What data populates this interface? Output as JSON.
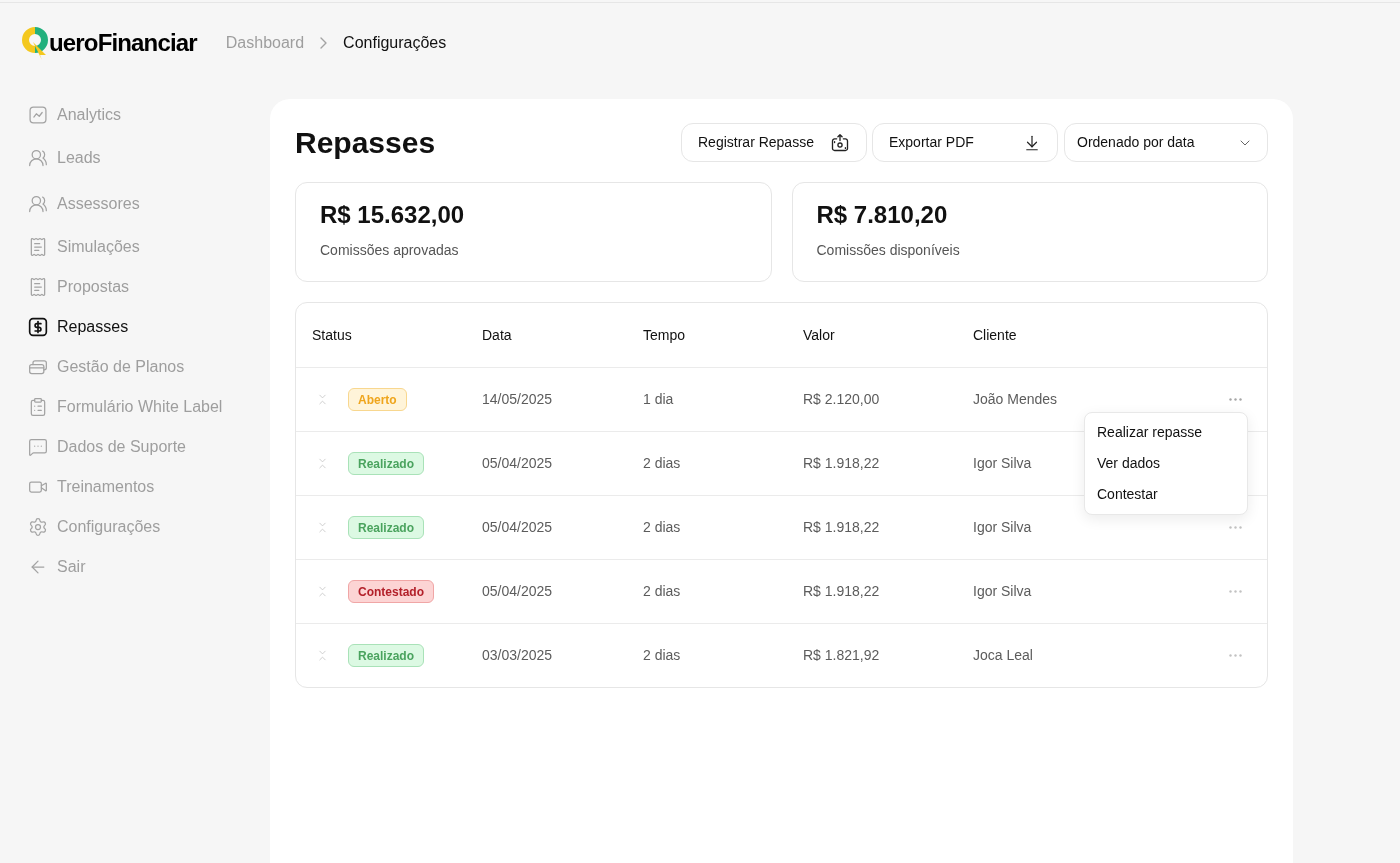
{
  "header": {
    "logo": {
      "text": "ueroFinanciar"
    },
    "breadcrumbs": [
      {
        "label": "Dashboard",
        "current": false
      },
      {
        "label": "Configurações",
        "current": true
      }
    ]
  },
  "sidebar": {
    "items": [
      {
        "label": "Analytics",
        "selected": false
      },
      {
        "label": "Leads",
        "selected": false
      },
      {
        "label": "Assessores",
        "selected": false
      },
      {
        "label": "Simulações",
        "selected": false
      },
      {
        "label": "Propostas",
        "selected": false
      },
      {
        "label": "Repasses",
        "selected": true
      },
      {
        "label": "Gestão de Planos",
        "selected": false
      },
      {
        "label": "Formulário White Label",
        "selected": false
      },
      {
        "label": "Dados de Suporte",
        "selected": false
      },
      {
        "label": "Treinamentos",
        "selected": false
      },
      {
        "label": "Configurações",
        "selected": false
      },
      {
        "label": "Sair",
        "selected": false
      }
    ]
  },
  "page": {
    "title": "Repasses",
    "actions": [
      {
        "label": "Registrar Repasse"
      },
      {
        "label": "Exportar PDF"
      }
    ],
    "sort": {
      "value": "Ordenado por data"
    },
    "stats": [
      {
        "value": "R$ 15.632,00",
        "label": "Comissões aprovadas"
      },
      {
        "value": "R$ 7.810,20",
        "label": "Comissões disponíveis"
      }
    ],
    "table": {
      "columns": [
        "Status",
        "Data",
        "Tempo",
        "Valor",
        "Cliente"
      ],
      "rows": [
        {
          "status": {
            "label": "Aberto",
            "kind": "open"
          },
          "date": "14/05/2025",
          "time": "1 dia",
          "value": "R$ 2.120,00",
          "client": "João Mendes",
          "menu_open": true
        },
        {
          "status": {
            "label": "Realizado",
            "kind": "done"
          },
          "date": "05/04/2025",
          "time": "2 dias",
          "value": "R$ 1.918,22",
          "client": "Igor Silva",
          "menu_open": false
        },
        {
          "status": {
            "label": "Realizado",
            "kind": "done"
          },
          "date": "05/04/2025",
          "time": "2 dias",
          "value": "R$ 1.918,22",
          "client": "Igor Silva",
          "menu_open": false
        },
        {
          "status": {
            "label": "Contestado",
            "kind": "disputed"
          },
          "date": "05/04/2025",
          "time": "2 dias",
          "value": "R$ 1.918,22",
          "client": "Igor Silva",
          "menu_open": false
        },
        {
          "status": {
            "label": "Realizado",
            "kind": "done"
          },
          "date": "03/03/2025",
          "time": "2 dias",
          "value": "R$ 1.821,92",
          "client": "Joca Leal",
          "menu_open": false
        }
      ]
    },
    "row_menu": {
      "items": [
        "Realizar repasse",
        "Ver dados",
        "Contestar"
      ]
    }
  }
}
